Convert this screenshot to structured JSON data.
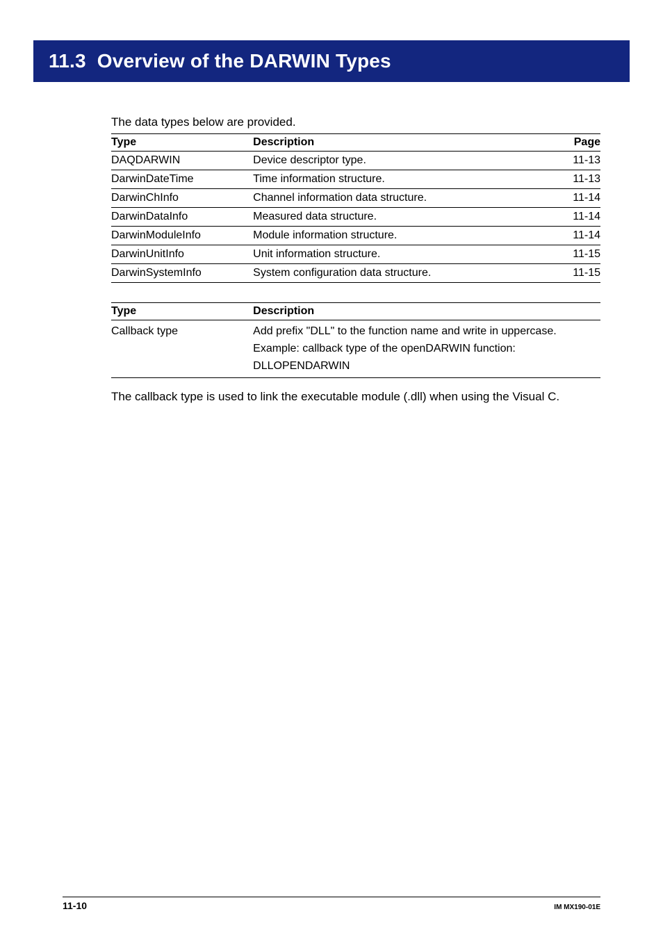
{
  "header": {
    "section_number": "11.3",
    "section_title": "Overview of the DARWIN Types"
  },
  "intro_text": "The data types below are provided.",
  "types_table": {
    "headers": {
      "type": "Type",
      "description": "Description",
      "page": "Page"
    },
    "rows": [
      {
        "type": "DAQDARWIN",
        "description": "Device descriptor type.",
        "page": "11-13"
      },
      {
        "type": "DarwinDateTime",
        "description": "Time information structure.",
        "page": "11-13"
      },
      {
        "type": "DarwinChInfo",
        "description": "Channel information data structure.",
        "page": "11-14"
      },
      {
        "type": "DarwinDataInfo",
        "description": "Measured data structure.",
        "page": "11-14"
      },
      {
        "type": "DarwinModuleInfo",
        "description": "Module information structure.",
        "page": "11-14"
      },
      {
        "type": "DarwinUnitInfo",
        "description": "Unit information structure.",
        "page": "11-15"
      },
      {
        "type": "DarwinSystemInfo",
        "description": "System configuration data structure.",
        "page": "11-15"
      }
    ]
  },
  "callback_table": {
    "headers": {
      "type": "Type",
      "description": "Description"
    },
    "row": {
      "type": "Callback type",
      "line1": "Add prefix \"DLL\" to the function name and write in uppercase.",
      "line2": "Example: callback type of the openDARWIN function:",
      "line3": "DLLOPENDARWIN"
    }
  },
  "note_text": "The callback type is used to link the executable module (.dll) when using the Visual C.",
  "footer": {
    "page_number": "11-10",
    "doc_id": "IM MX190-01E"
  }
}
